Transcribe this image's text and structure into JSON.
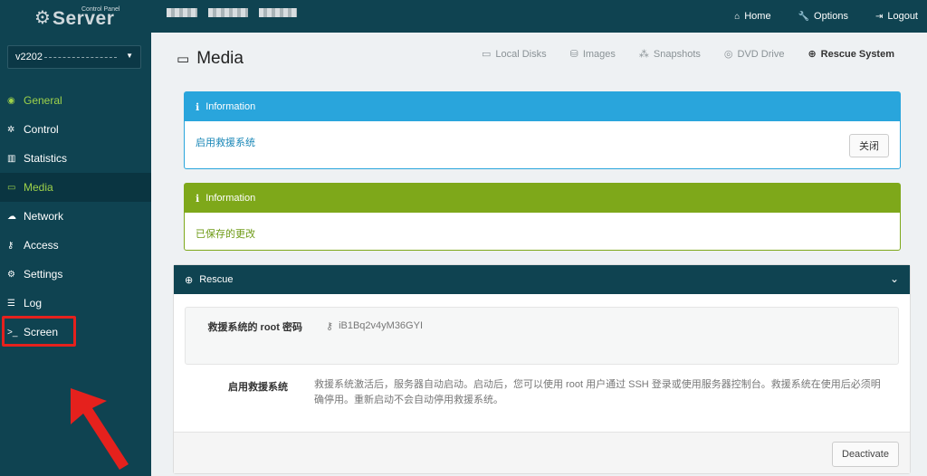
{
  "brand": {
    "small": "Control Panel",
    "big": "Server"
  },
  "topnav": {
    "home": "Home",
    "options": "Options",
    "logout": "Logout"
  },
  "sidebar": {
    "server_prefix": "v2202",
    "items": [
      {
        "label": "General",
        "icon": "eye-icon"
      },
      {
        "label": "Control",
        "icon": "gear-icon"
      },
      {
        "label": "Statistics",
        "icon": "bar-chart-icon"
      },
      {
        "label": "Media",
        "icon": "hdd-icon"
      },
      {
        "label": "Network",
        "icon": "cloud-icon"
      },
      {
        "label": "Access",
        "icon": "key-icon"
      },
      {
        "label": "Settings",
        "icon": "gears-icon"
      },
      {
        "label": "Log",
        "icon": "list-icon"
      },
      {
        "label": "Screen",
        "icon": "terminal-icon"
      }
    ]
  },
  "page": {
    "title": "Media"
  },
  "tabs": [
    "Local Disks",
    "Images",
    "Snapshots",
    "DVD Drive",
    "Rescue System"
  ],
  "alerts": [
    {
      "title": "Information",
      "message": "启用救援系统",
      "button": "关闭",
      "color": "#29a5dc"
    },
    {
      "title": "Information",
      "message": "已保存的更改",
      "color": "#7ea81a"
    }
  ],
  "rescue": {
    "title": "Rescue",
    "password_label": "救援系统的 root 密码",
    "password_value": "iB1Bq2v4yM36GYI",
    "activate_label": "启用救援系统",
    "activate_desc": "救援系统激活后，服务器自动启动。启动后，您可以使用 root 用户通过 SSH 登录或使用服务器控制台。救援系统在使用后必须明确停用。重新启动不会自动停用救援系统。",
    "deactivate_button": "Deactivate"
  },
  "colors": {
    "sidebar_bg": "#0f4351",
    "accent_green": "#9ed24a",
    "info_blue": "#29a5dc",
    "success_green": "#7ea81a",
    "highlight_red": "#e5211d"
  }
}
